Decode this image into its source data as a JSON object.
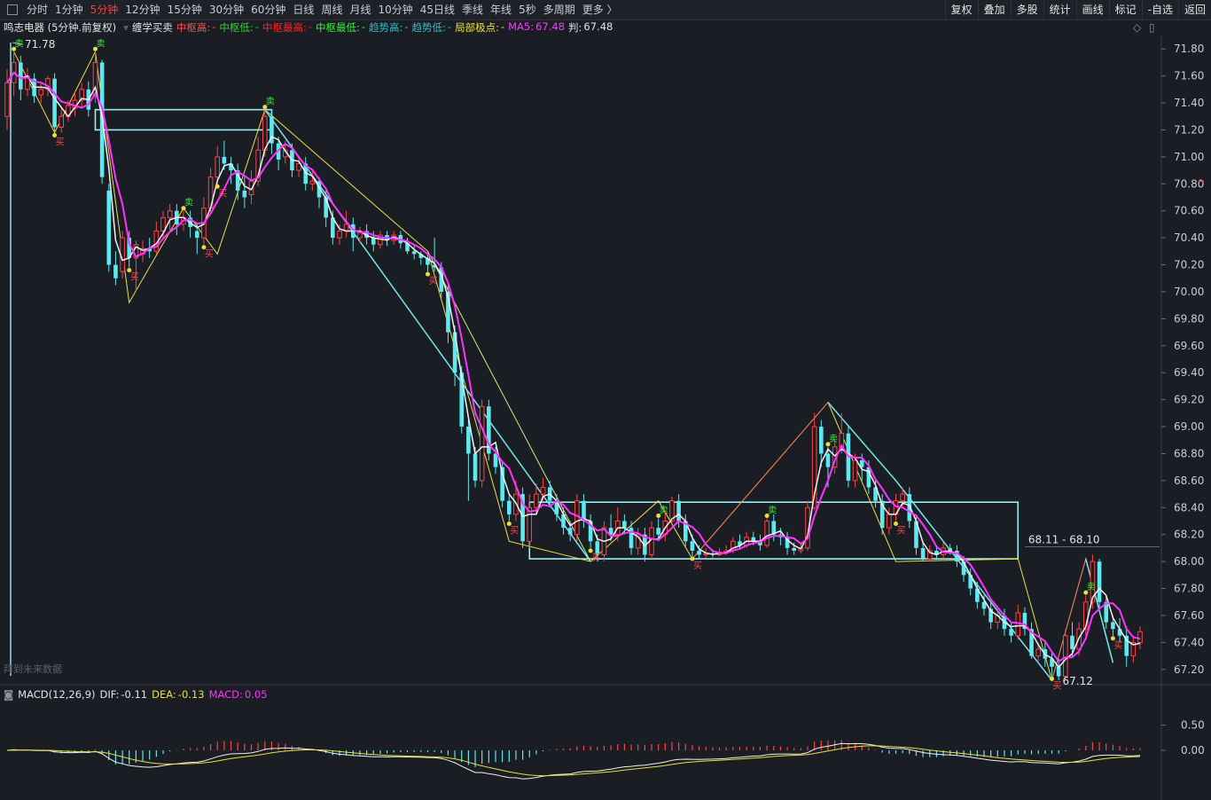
{
  "toolbar": {
    "periods": [
      "分时",
      "1分钟",
      "5分钟",
      "12分钟",
      "15分钟",
      "30分钟",
      "60分钟",
      "日线",
      "周线",
      "月线",
      "10分钟",
      "45日线",
      "季线",
      "年线",
      "5秒",
      "多周期",
      "更多 〉"
    ],
    "active_index": 2,
    "tools": [
      "复权",
      "叠加",
      "多股",
      "统计",
      "画线",
      "标记",
      "-自选",
      "返回"
    ]
  },
  "info": {
    "stock": "鸣志电器 (5分钟.前复权)",
    "indicator": "缠学买卖",
    "items": [
      {
        "label": "中枢高:",
        "value": "-",
        "color": "#ff5050"
      },
      {
        "label": "中枢低:",
        "value": "-",
        "color": "#33cc33"
      },
      {
        "label": "中枢最高:",
        "value": "-",
        "color": "#ff2222"
      },
      {
        "label": "中枢最低:",
        "value": "-",
        "color": "#33ee33"
      },
      {
        "label": "趋势高:",
        "value": "-",
        "color": "#33bbcc"
      },
      {
        "label": "趋势低:",
        "value": "-",
        "color": "#33bbcc"
      },
      {
        "label": "局部极点:",
        "value": "-",
        "color": "#e8e040"
      },
      {
        "label": "MA5:",
        "value": "67.48",
        "color": "#ff33ff"
      },
      {
        "label": "判:",
        "value": "67.48",
        "color": "#e0e3e8"
      }
    ]
  },
  "macd_info": {
    "name": "MACD(12,26,9)",
    "items": [
      {
        "label": "DIF:",
        "value": "-0.11",
        "color": "#e0e3e8"
      },
      {
        "label": "DEA:",
        "value": "-0.13",
        "color": "#e8e040"
      },
      {
        "label": "MACD:",
        "value": "0.05",
        "color": "#ff33ff"
      }
    ]
  },
  "future_label": "拜到未来数据",
  "chart_data": {
    "type": "candlestick",
    "price_axis": {
      "min": 67.1,
      "max": 71.9,
      "ticks": [
        "71.80",
        "71.60",
        "71.40",
        "71.20",
        "71.00",
        "70.80",
        "70.60",
        "70.40",
        "70.20",
        "70.00",
        "69.80",
        "69.60",
        "69.40",
        "69.20",
        "69.00",
        "68.80",
        "68.60",
        "68.40",
        "68.20",
        "68.00",
        "67.80",
        "67.60",
        "67.40",
        "67.20"
      ]
    },
    "macd_axis": {
      "min": -0.95,
      "max": 0.95,
      "ticks": [
        "0.50",
        "0.00"
      ]
    },
    "annotations": {
      "high": "71.78",
      "low": "67.12",
      "range": "68.11 - 68.10",
      "buy": "买",
      "sell": "卖"
    },
    "candles": [
      [
        71.3,
        71.55,
        71.65,
        71.2
      ],
      [
        71.55,
        71.7,
        71.78,
        71.45
      ],
      [
        71.7,
        71.5,
        71.75,
        71.42
      ],
      [
        71.5,
        71.6,
        71.66,
        71.45
      ],
      [
        71.58,
        71.45,
        71.62,
        71.4
      ],
      [
        71.46,
        71.5,
        71.55,
        71.4
      ],
      [
        71.5,
        71.58,
        71.6,
        71.45
      ],
      [
        71.58,
        71.22,
        71.62,
        71.18
      ],
      [
        71.22,
        71.3,
        71.36,
        71.18
      ],
      [
        71.3,
        71.38,
        71.42,
        71.26
      ],
      [
        71.36,
        71.42,
        71.48,
        71.3
      ],
      [
        71.42,
        71.5,
        71.55,
        71.36
      ],
      [
        71.5,
        71.35,
        71.56,
        71.3
      ],
      [
        71.45,
        71.7,
        71.78,
        71.4
      ],
      [
        71.7,
        70.85,
        71.72,
        70.8
      ],
      [
        70.75,
        70.2,
        70.8,
        70.15
      ],
      [
        70.2,
        70.1,
        70.3,
        70.05
      ],
      [
        70.15,
        70.4,
        70.45,
        70.1
      ],
      [
        70.4,
        70.25,
        70.45,
        70.18
      ],
      [
        70.25,
        70.35,
        70.38,
        70.0
      ],
      [
        70.28,
        70.32,
        70.38,
        70.22
      ],
      [
        70.32,
        70.3,
        70.4,
        70.25
      ],
      [
        70.3,
        70.45,
        70.52,
        70.28
      ],
      [
        70.45,
        70.55,
        70.6,
        70.4
      ],
      [
        70.55,
        70.6,
        70.65,
        70.45
      ],
      [
        70.6,
        70.5,
        70.65,
        70.42
      ],
      [
        70.5,
        70.55,
        70.6,
        70.45
      ],
      [
        70.55,
        70.48,
        70.6,
        70.4
      ],
      [
        70.45,
        70.4,
        70.5,
        70.28
      ],
      [
        70.4,
        70.62,
        70.7,
        70.35
      ],
      [
        70.62,
        70.85,
        70.92,
        70.58
      ],
      [
        70.85,
        71.0,
        71.08,
        70.8
      ],
      [
        71.0,
        70.95,
        71.12,
        70.9
      ],
      [
        70.95,
        70.9,
        71.0,
        70.8
      ],
      [
        70.9,
        70.75,
        70.95,
        70.68
      ],
      [
        70.75,
        70.7,
        70.85,
        70.62
      ],
      [
        70.72,
        70.82,
        70.9,
        70.65
      ],
      [
        70.82,
        71.05,
        71.15,
        70.78
      ],
      [
        71.05,
        71.3,
        71.35,
        71.0
      ],
      [
        71.3,
        71.1,
        71.35,
        71.02
      ],
      [
        71.1,
        70.98,
        71.15,
        70.9
      ],
      [
        71.0,
        71.05,
        71.12,
        70.95
      ],
      [
        71.05,
        70.9,
        71.1,
        70.85
      ],
      [
        70.9,
        70.95,
        71.0,
        70.85
      ],
      [
        70.95,
        70.8,
        71.0,
        70.75
      ],
      [
        70.8,
        70.82,
        70.9,
        70.75
      ],
      [
        70.82,
        70.7,
        70.85,
        70.62
      ],
      [
        70.7,
        70.55,
        70.75,
        70.48
      ],
      [
        70.55,
        70.4,
        70.6,
        70.35
      ],
      [
        70.4,
        70.45,
        70.5,
        70.35
      ],
      [
        70.45,
        70.5,
        70.6,
        70.4
      ],
      [
        70.5,
        70.4,
        70.55,
        70.3
      ],
      [
        70.4,
        70.45,
        70.48,
        70.36
      ],
      [
        70.45,
        70.4,
        70.5,
        70.35
      ],
      [
        70.4,
        70.35,
        70.45,
        70.3
      ],
      [
        70.35,
        70.42,
        70.45,
        70.32
      ],
      [
        70.42,
        70.38,
        70.45,
        70.34
      ],
      [
        70.38,
        70.42,
        70.45,
        70.35
      ],
      [
        70.42,
        70.36,
        70.45,
        70.32
      ],
      [
        70.36,
        70.3,
        70.4,
        70.28
      ],
      [
        70.3,
        70.28,
        70.34,
        70.24
      ],
      [
        70.28,
        70.25,
        70.3,
        70.2
      ],
      [
        70.25,
        70.2,
        70.28,
        70.15
      ],
      [
        70.2,
        70.18,
        70.4,
        70.15
      ],
      [
        70.18,
        70.0,
        70.22,
        69.95
      ],
      [
        70.0,
        69.7,
        70.05,
        69.62
      ],
      [
        69.7,
        69.4,
        69.75,
        69.3
      ],
      [
        69.4,
        69.0,
        69.45,
        68.95
      ],
      [
        69.0,
        68.8,
        69.05,
        68.45
      ],
      [
        68.8,
        68.6,
        68.85,
        68.55
      ],
      [
        68.6,
        69.15,
        69.2,
        68.55
      ],
      [
        69.15,
        68.8,
        69.2,
        68.75
      ],
      [
        68.8,
        68.7,
        68.85,
        68.65
      ],
      [
        68.7,
        68.45,
        68.75,
        68.4
      ],
      [
        68.45,
        68.35,
        68.5,
        68.3
      ],
      [
        68.35,
        68.5,
        68.6,
        68.3
      ],
      [
        68.5,
        68.15,
        68.55,
        68.1
      ],
      [
        68.15,
        68.4,
        68.5,
        68.1
      ],
      [
        68.4,
        68.5,
        68.58,
        68.35
      ],
      [
        68.5,
        68.55,
        68.62,
        68.45
      ],
      [
        68.55,
        68.45,
        68.6,
        68.4
      ],
      [
        68.45,
        68.35,
        68.5,
        68.3
      ],
      [
        68.35,
        68.25,
        68.4,
        68.2
      ],
      [
        68.25,
        68.2,
        68.3,
        68.15
      ],
      [
        68.2,
        68.45,
        68.5,
        68.15
      ],
      [
        68.45,
        68.3,
        68.5,
        68.25
      ],
      [
        68.3,
        68.15,
        68.35,
        68.1
      ],
      [
        68.15,
        68.05,
        68.2,
        68.0
      ],
      [
        68.05,
        68.25,
        68.3,
        68.0
      ],
      [
        68.25,
        68.2,
        68.35,
        68.15
      ],
      [
        68.2,
        68.3,
        68.4,
        68.15
      ],
      [
        68.3,
        68.25,
        68.35,
        68.2
      ],
      [
        68.25,
        68.1,
        68.3,
        68.05
      ],
      [
        68.1,
        68.2,
        68.25,
        68.05
      ],
      [
        68.2,
        68.05,
        68.25,
        68.0
      ],
      [
        68.05,
        68.25,
        68.3,
        68.02
      ],
      [
        68.25,
        68.2,
        68.32,
        68.15
      ],
      [
        68.2,
        68.3,
        68.38,
        68.15
      ],
      [
        68.3,
        68.45,
        68.48,
        68.28
      ],
      [
        68.45,
        68.3,
        68.5,
        68.25
      ],
      [
        68.3,
        68.15,
        68.35,
        68.1
      ],
      [
        68.15,
        68.08,
        68.2,
        68.04
      ],
      [
        68.08,
        68.05,
        68.12,
        68.02
      ],
      [
        68.05,
        68.06,
        68.1,
        68.03
      ],
      [
        68.06,
        68.05,
        68.09,
        68.03
      ],
      [
        68.05,
        68.07,
        68.1,
        68.04
      ],
      [
        68.07,
        68.08,
        68.12,
        68.05
      ],
      [
        68.08,
        68.15,
        68.18,
        68.06
      ],
      [
        68.15,
        68.12,
        68.2,
        68.1
      ],
      [
        68.12,
        68.18,
        68.22,
        68.1
      ],
      [
        68.18,
        68.15,
        68.22,
        68.12
      ],
      [
        68.15,
        68.12,
        68.2,
        68.08
      ],
      [
        68.12,
        68.3,
        68.32,
        68.1
      ],
      [
        68.3,
        68.2,
        68.35,
        68.15
      ],
      [
        68.2,
        68.18,
        68.25,
        68.12
      ],
      [
        68.18,
        68.1,
        68.22,
        68.05
      ],
      [
        68.1,
        68.08,
        68.14,
        68.05
      ],
      [
        68.08,
        68.1,
        68.14,
        68.06
      ],
      [
        68.1,
        68.4,
        68.45,
        68.08
      ],
      [
        68.4,
        69.0,
        69.1,
        68.38
      ],
      [
        69.0,
        68.8,
        69.05,
        68.7
      ],
      [
        68.8,
        68.7,
        68.85,
        68.55
      ],
      [
        68.7,
        68.85,
        68.9,
        68.65
      ],
      [
        68.85,
        68.95,
        69.1,
        68.8
      ],
      [
        68.95,
        68.6,
        69.0,
        68.55
      ],
      [
        68.6,
        68.75,
        68.8,
        68.55
      ],
      [
        68.75,
        68.7,
        68.8,
        68.6
      ],
      [
        68.7,
        68.55,
        68.75,
        68.5
      ],
      [
        68.55,
        68.45,
        68.6,
        68.4
      ],
      [
        68.45,
        68.25,
        68.5,
        68.2
      ],
      [
        68.25,
        68.35,
        68.4,
        68.2
      ],
      [
        68.35,
        68.45,
        68.5,
        68.3
      ],
      [
        68.45,
        68.5,
        68.55,
        68.4
      ],
      [
        68.5,
        68.3,
        68.55,
        68.25
      ],
      [
        68.3,
        68.1,
        68.35,
        68.05
      ],
      [
        68.1,
        68.02,
        68.15,
        68.0
      ],
      [
        68.02,
        68.08,
        68.12,
        68.0
      ],
      [
        68.08,
        68.05,
        68.12,
        68.02
      ],
      [
        68.05,
        68.1,
        68.14,
        68.02
      ],
      [
        68.1,
        68.08,
        68.13,
        68.05
      ],
      [
        68.08,
        68.0,
        68.12,
        67.96
      ],
      [
        68.0,
        67.9,
        68.04,
        67.85
      ],
      [
        67.9,
        67.8,
        67.95,
        67.75
      ],
      [
        67.8,
        67.7,
        67.85,
        67.65
      ],
      [
        67.7,
        67.65,
        67.75,
        67.6
      ],
      [
        67.65,
        67.55,
        67.7,
        67.5
      ],
      [
        67.55,
        67.6,
        67.65,
        67.5
      ],
      [
        67.6,
        67.5,
        67.65,
        67.45
      ],
      [
        67.5,
        67.45,
        67.55,
        67.4
      ],
      [
        67.45,
        67.62,
        67.68,
        67.42
      ],
      [
        67.62,
        67.5,
        67.66,
        67.45
      ],
      [
        67.5,
        67.3,
        67.55,
        67.28
      ],
      [
        67.3,
        67.35,
        67.4,
        67.25
      ],
      [
        67.35,
        67.28,
        67.4,
        67.22
      ],
      [
        67.28,
        67.22,
        67.32,
        67.15
      ],
      [
        67.22,
        67.15,
        67.28,
        67.12
      ],
      [
        67.15,
        67.45,
        67.5,
        67.12
      ],
      [
        67.45,
        67.35,
        67.55,
        67.3
      ],
      [
        67.35,
        67.5,
        67.55,
        67.3
      ],
      [
        67.5,
        67.7,
        67.75,
        67.45
      ],
      [
        67.7,
        68.0,
        68.05,
        67.65
      ],
      [
        68.0,
        67.7,
        68.02,
        67.65
      ],
      [
        67.7,
        67.55,
        67.75,
        67.5
      ],
      [
        67.55,
        67.5,
        67.6,
        67.45
      ],
      [
        67.5,
        67.45,
        67.58,
        67.4
      ],
      [
        67.45,
        67.3,
        67.52,
        67.22
      ],
      [
        67.3,
        67.4,
        67.45,
        67.25
      ],
      [
        67.4,
        67.48,
        67.52,
        67.35
      ]
    ],
    "zones": [
      {
        "from": 13,
        "to": 39,
        "high": 71.35,
        "low": 71.2
      },
      {
        "from": 77,
        "to": 149,
        "high": 68.44,
        "low": 68.02
      }
    ]
  }
}
